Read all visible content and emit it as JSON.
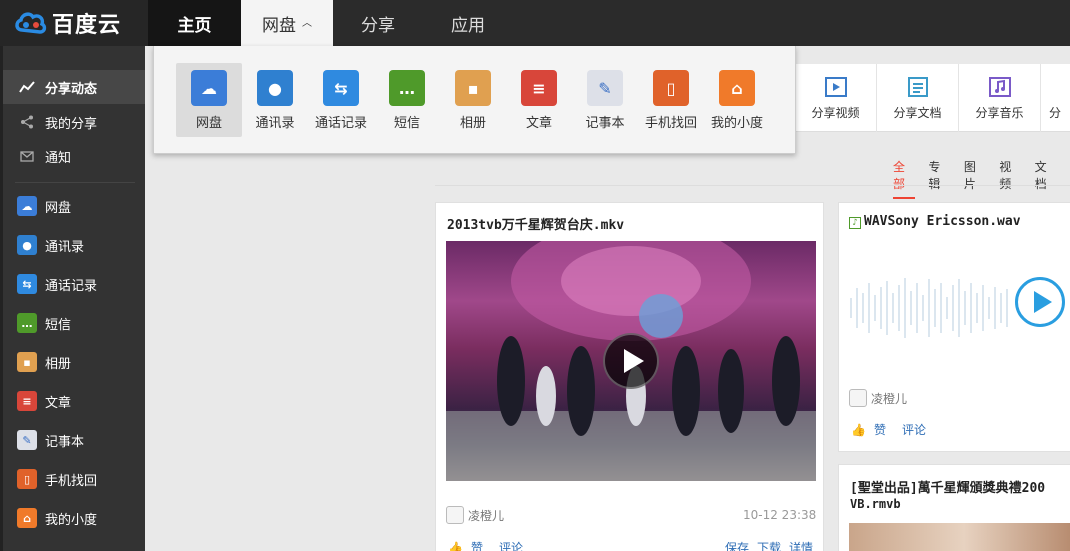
{
  "brand": {
    "name": "百度云"
  },
  "topnav": {
    "home": "主页",
    "disk": "网盘",
    "share": "分享",
    "apps": "应用"
  },
  "dropdown": [
    {
      "label": "网盘",
      "icon": "cloud-icon",
      "color": "#3b7dd8"
    },
    {
      "label": "通讯录",
      "icon": "contacts-icon",
      "color": "#2f80d0"
    },
    {
      "label": "通话记录",
      "icon": "call-log-icon",
      "color": "#2f8ae0"
    },
    {
      "label": "短信",
      "icon": "sms-icon",
      "color": "#4f9a2a"
    },
    {
      "label": "相册",
      "icon": "album-icon",
      "color": "#e0a050"
    },
    {
      "label": "文章",
      "icon": "article-icon",
      "color": "#d8463a"
    },
    {
      "label": "记事本",
      "icon": "notepad-icon",
      "color": "#dde0e8"
    },
    {
      "label": "手机找回",
      "icon": "phone-find-icon",
      "color": "#e0622a"
    },
    {
      "label": "我的小度",
      "icon": "home-icon",
      "color": "#f07a2a"
    }
  ],
  "sidebar": {
    "feed": "分享动态",
    "myshare": "我的分享",
    "notice": "通知",
    "apps": [
      {
        "label": "网盘",
        "icon": "cloud-icon",
        "color": "#3b7dd8"
      },
      {
        "label": "通讯录",
        "icon": "contacts-icon",
        "color": "#2f80d0"
      },
      {
        "label": "通话记录",
        "icon": "call-log-icon",
        "color": "#2f8ae0"
      },
      {
        "label": "短信",
        "icon": "sms-icon",
        "color": "#4f9a2a"
      },
      {
        "label": "相册",
        "icon": "album-icon",
        "color": "#e0a050"
      },
      {
        "label": "文章",
        "icon": "article-icon",
        "color": "#d8463a"
      },
      {
        "label": "记事本",
        "icon": "notepad-icon",
        "color": "#dde0e8"
      },
      {
        "label": "手机找回",
        "icon": "phone-find-icon",
        "color": "#e0622a"
      },
      {
        "label": "我的小度",
        "icon": "home-icon",
        "color": "#f07a2a"
      }
    ]
  },
  "sharebar": {
    "video": "分享视频",
    "doc": "分享文档",
    "music": "分享音乐",
    "more": "分"
  },
  "filters": {
    "all": "全部",
    "album": "专辑",
    "picture": "图片",
    "video": "视频",
    "doc": "文档"
  },
  "cards": {
    "video": {
      "title": "2013tvb万千星辉贺台庆.mkv",
      "user": "凌橙儿",
      "time": "10-12 23:38",
      "like": "赞",
      "comment": "评论",
      "save": "保存",
      "download": "下载",
      "detail": "详情"
    },
    "audio": {
      "title": "WAVSony Ericsson.wav",
      "user": "凌橙儿",
      "like": "赞",
      "comment": "评论"
    },
    "rmvb": {
      "title_line1": "[聖堂出品]萬千星輝頒獎典禮200",
      "title_line2": "VB.rmvb"
    }
  }
}
